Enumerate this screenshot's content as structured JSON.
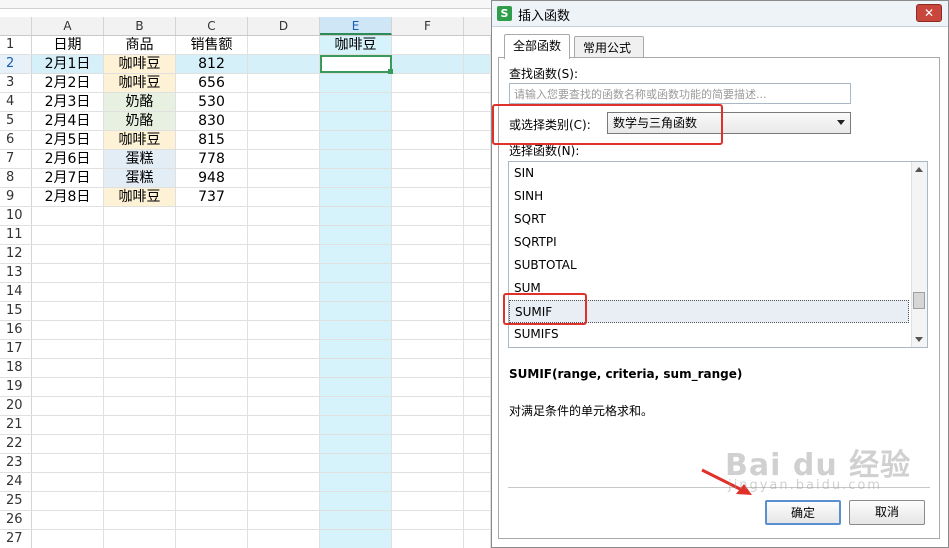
{
  "sheet": {
    "columns": [
      "A",
      "B",
      "C",
      "D",
      "E",
      "F"
    ],
    "selected_column": "E",
    "rows": [
      {
        "num": "1",
        "a": "日期",
        "b": "商品",
        "c": "销售额",
        "e": "咖啡豆",
        "fill": ""
      },
      {
        "num": "2",
        "a": "2月1日",
        "b": "咖啡豆",
        "c": "812",
        "e": "",
        "fill": "coffee"
      },
      {
        "num": "3",
        "a": "2月2日",
        "b": "咖啡豆",
        "c": "656",
        "e": "",
        "fill": "coffee"
      },
      {
        "num": "4",
        "a": "2月3日",
        "b": "奶酪",
        "c": "530",
        "e": "",
        "fill": "cheese"
      },
      {
        "num": "5",
        "a": "2月4日",
        "b": "奶酪",
        "c": "830",
        "e": "",
        "fill": "cheese"
      },
      {
        "num": "6",
        "a": "2月5日",
        "b": "咖啡豆",
        "c": "815",
        "e": "",
        "fill": "coffee"
      },
      {
        "num": "7",
        "a": "2月6日",
        "b": "蛋糕",
        "c": "778",
        "e": "",
        "fill": "cake"
      },
      {
        "num": "8",
        "a": "2月7日",
        "b": "蛋糕",
        "c": "948",
        "e": "",
        "fill": "cake"
      },
      {
        "num": "9",
        "a": "2月8日",
        "b": "咖啡豆",
        "c": "737",
        "e": "",
        "fill": "coffee"
      },
      {
        "num": "10"
      },
      {
        "num": "11"
      },
      {
        "num": "12"
      },
      {
        "num": "13"
      },
      {
        "num": "14"
      },
      {
        "num": "15"
      },
      {
        "num": "16"
      },
      {
        "num": "17"
      },
      {
        "num": "18"
      },
      {
        "num": "19"
      },
      {
        "num": "20"
      },
      {
        "num": "21"
      },
      {
        "num": "22"
      },
      {
        "num": "23"
      },
      {
        "num": "24"
      },
      {
        "num": "25"
      },
      {
        "num": "26"
      },
      {
        "num": "27"
      }
    ],
    "active_row": "2"
  },
  "dialog": {
    "title": "插入函数",
    "app_icon": "S",
    "close_label": "✕",
    "tabs": [
      {
        "label": "全部函数",
        "active": true
      },
      {
        "label": "常用公式",
        "active": false
      }
    ],
    "search_label": "查找函数(S):",
    "search_placeholder": "请输入您要查找的函数名称或函数功能的简要描述...",
    "category_label": "或选择类别(C):",
    "category_value": "数学与三角函数",
    "list_label": "选择函数(N):",
    "functions": [
      "SIN",
      "SINH",
      "SQRT",
      "SQRTPI",
      "SUBTOTAL",
      "SUM",
      "SUMIF",
      "SUMIFS"
    ],
    "selected_function": "SUMIF",
    "signature": "SUMIF(range, criteria, sum_range)",
    "description": "对满足条件的单元格求和。",
    "ok_label": "确定",
    "cancel_label": "取消"
  },
  "watermark": {
    "main": "Bai du 经验",
    "sub": "jingyan.baidu.com"
  },
  "colors": {
    "highlight": "#e0302a",
    "selected_column": "#d6f3fb",
    "active_cell_border": "#3a9a5c"
  }
}
